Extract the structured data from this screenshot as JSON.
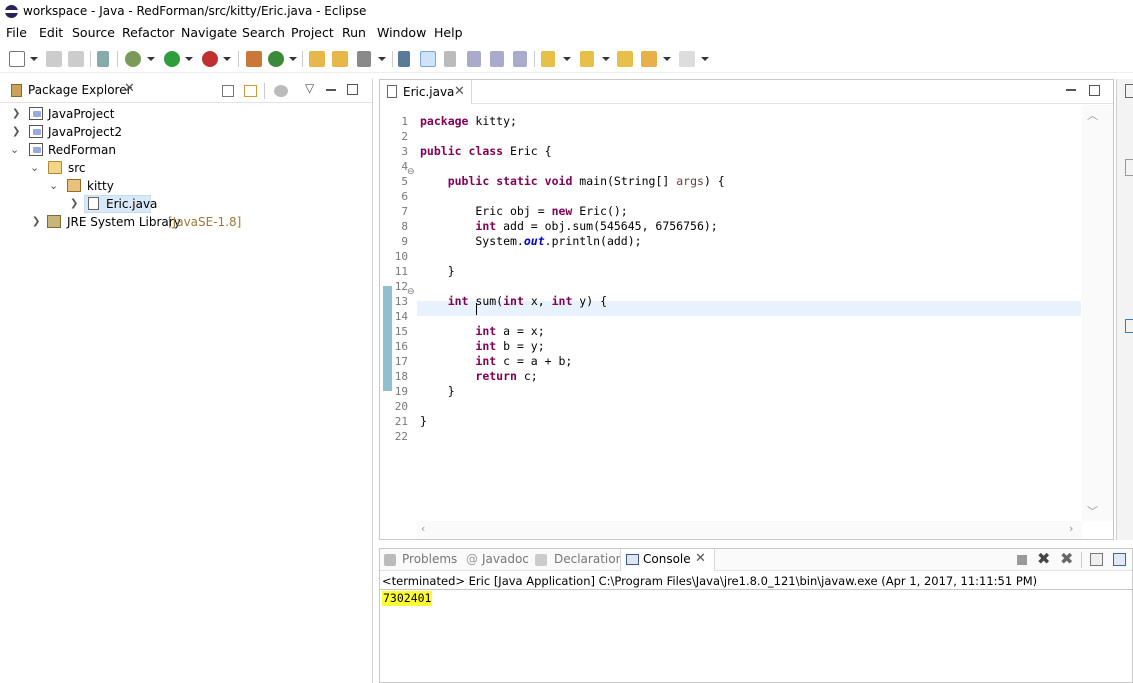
{
  "window": {
    "title": "workspace - Java - RedForman/src/kitty/Eric.java - Eclipse"
  },
  "menu": [
    "File",
    "Edit",
    "Source",
    "Refactor",
    "Navigate",
    "Search",
    "Project",
    "Run",
    "Window",
    "Help"
  ],
  "package_explorer": {
    "tab_label": "Package Explorer",
    "items": [
      {
        "label": "JavaProject",
        "arrow": ">",
        "type": "project"
      },
      {
        "label": "JavaProject2",
        "arrow": ">",
        "type": "project"
      },
      {
        "label": "RedForman",
        "arrow": "v",
        "type": "project"
      },
      {
        "label": "src",
        "arrow": "v",
        "type": "folder"
      },
      {
        "label": "kitty",
        "arrow": "v",
        "type": "package"
      },
      {
        "label": "Eric.java",
        "arrow": ">",
        "type": "file",
        "selected": true
      },
      {
        "label": "JRE System Library",
        "suffix": "[JavaSE-1.8]",
        "arrow": ">",
        "type": "library"
      }
    ]
  },
  "editor": {
    "tab_label": "Eric.java",
    "line_numbers": [
      "1",
      "2",
      "3",
      "4",
      "5",
      "6",
      "7",
      "8",
      "9",
      "10",
      "11",
      "12",
      "13",
      "14",
      "15",
      "16",
      "17",
      "18",
      "19",
      "20",
      "21",
      "22"
    ],
    "lines": [
      "package kitty;",
      "",
      "public class Eric {",
      "",
      "    public static void main(String[] args) {",
      "",
      "        Eric obj = new Eric();",
      "        int add = obj.sum(545645, 6756756);",
      "        System.out.println(add);",
      "",
      "    }",
      "",
      "    int sum(int x, int y) {",
      "        ",
      "        int a = x;",
      "        int b = y;",
      "        int c = a + b;",
      "        return c;",
      "    }",
      "",
      "}",
      ""
    ]
  },
  "console": {
    "tabs": [
      "Problems",
      "Javadoc",
      "Declaration",
      "Console"
    ],
    "active_tab": "Console",
    "status": "<terminated> Eric [Java Application] C:\\Program Files\\Java\\jre1.8.0_121\\bin\\javaw.exe (Apr 1, 2017, 11:11:51 PM)",
    "output": "7302401",
    "highlight_color": "#ffff33"
  },
  "colors": {
    "keyword": "#7f0055",
    "field": "#0000c0",
    "selection": "#d9e8f7",
    "current_line": "#e8f2fe"
  }
}
